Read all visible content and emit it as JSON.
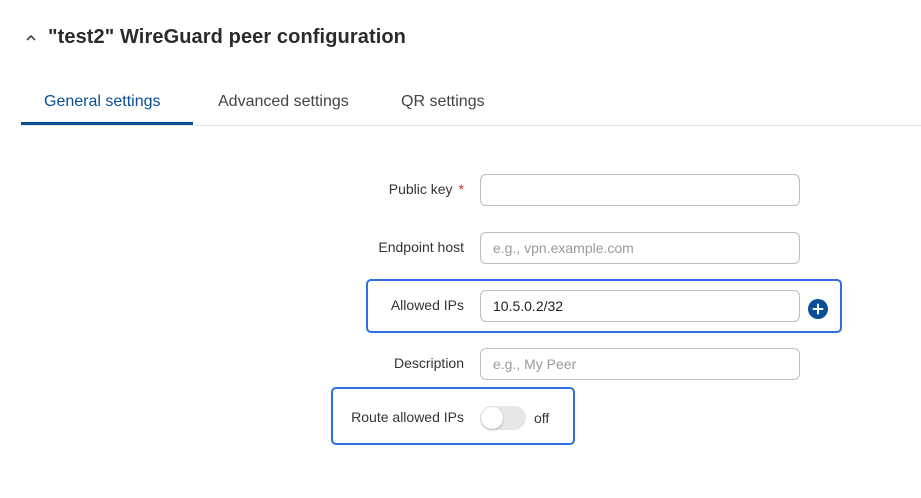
{
  "header": {
    "title": "\"test2\" WireGuard peer configuration",
    "collapse_icon": "chevron-up-icon"
  },
  "tabs": [
    {
      "label": "General settings",
      "active": true
    },
    {
      "label": "Advanced settings",
      "active": false
    },
    {
      "label": "QR settings",
      "active": false
    }
  ],
  "form": {
    "public_key": {
      "label": "Public key",
      "required_mark": "*",
      "value": "",
      "placeholder": ""
    },
    "endpoint_host": {
      "label": "Endpoint host",
      "value": "",
      "placeholder": "e.g., vpn.example.com"
    },
    "allowed_ips": {
      "label": "Allowed IPs",
      "value": "10.5.0.2/32",
      "add_icon": "plus-circle-icon"
    },
    "description": {
      "label": "Description",
      "value": "",
      "placeholder": "e.g., My Peer"
    },
    "route_allowed_ips": {
      "label": "Route allowed IPs",
      "state_text": "off",
      "enabled": false
    }
  },
  "colors": {
    "accent": "#0a4f95",
    "highlight": "#2f6fe0",
    "required": "#d0312d"
  }
}
